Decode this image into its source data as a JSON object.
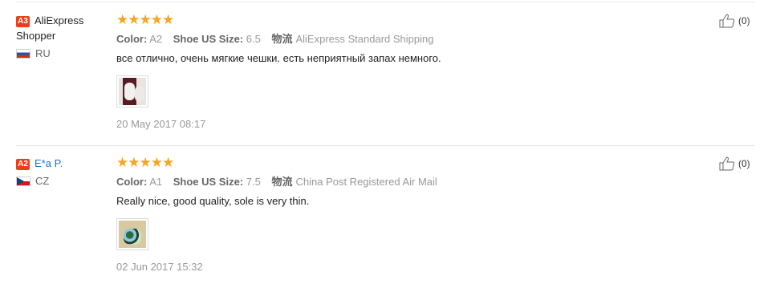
{
  "reviews": [
    {
      "level": "A3",
      "user": "AliExpress Shopper",
      "country": "RU",
      "stars": "★★★★★",
      "color_label": "Color:",
      "color_value": "A2",
      "size_label": "Shoe US Size:",
      "size_value": "6.5",
      "ship_label": "物流",
      "ship_value": "AliExpress Standard Shipping",
      "text": "все отлично, очень мягкие чешки. есть неприятный запах немного.",
      "date": "20 May 2017 08:17",
      "helpful": "(0)"
    },
    {
      "level": "A2",
      "user": "E*a P.",
      "country": "CZ",
      "stars": "★★★★★",
      "color_label": "Color:",
      "color_value": "A1",
      "size_label": "Shoe US Size:",
      "size_value": "7.5",
      "ship_label": "物流",
      "ship_value": "China Post Registered Air Mail",
      "text": "Really nice, good quality, sole is very thin.",
      "date": "02 Jun 2017 15:32",
      "helpful": "(0)"
    }
  ],
  "icons": {
    "thumb": "thumbs-up-icon",
    "flags": [
      "russia-flag-icon",
      "czech-flag-icon"
    ]
  },
  "colors": {
    "star": "#f5a623",
    "badge": "#e6411a",
    "link": "#1c74c7"
  }
}
